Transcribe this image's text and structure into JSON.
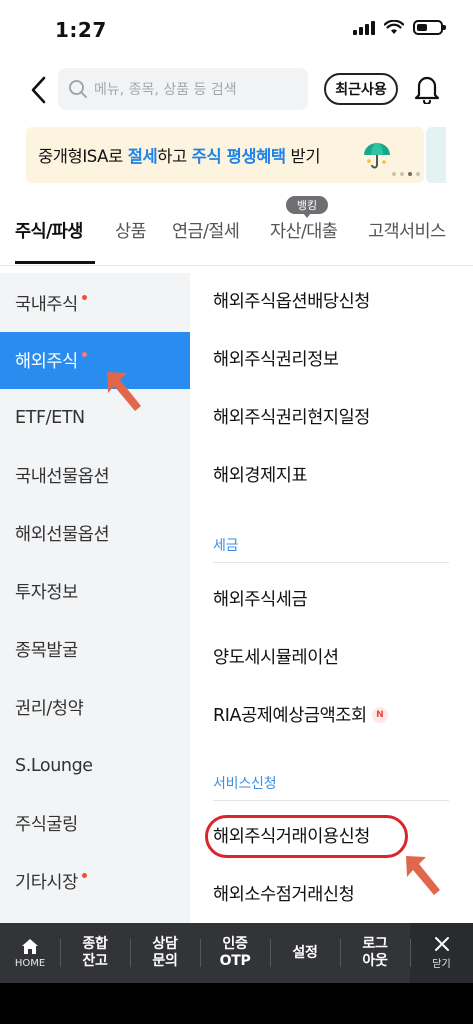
{
  "status": {
    "time": "1:27"
  },
  "header": {
    "search_placeholder": "메뉴, 종목, 상품 등 검색",
    "recent_label": "최근사용"
  },
  "banner": {
    "part1": "중개형ISA로 ",
    "part2": "절세",
    "part3": "하고 ",
    "part4": "주식 평생혜택",
    "part5": " 받기"
  },
  "tabs": [
    {
      "label": "주식/파생",
      "active": true
    },
    {
      "label": "상품"
    },
    {
      "label": "연금/절세"
    },
    {
      "label": "자산/대출"
    },
    {
      "label": "고객서비스"
    }
  ],
  "tab_badge": "뱅킹",
  "sidebar": {
    "items": [
      {
        "label": "국내주식",
        "dot": true
      },
      {
        "label": "해외주식",
        "dot": true,
        "active": true
      },
      {
        "label": "ETF/ETN"
      },
      {
        "label": "국내선물옵션"
      },
      {
        "label": "해외선물옵션"
      },
      {
        "label": "투자정보"
      },
      {
        "label": "종목발굴"
      },
      {
        "label": "권리/청약"
      },
      {
        "label": "S.Lounge"
      },
      {
        "label": "주식굴링"
      },
      {
        "label": "기타시장",
        "dot": true
      }
    ]
  },
  "content": {
    "items_top": [
      "해외주식옵션배당신청",
      "해외주식권리정보",
      "해외주식권리현지일정",
      "해외경제지표"
    ],
    "section_tax": {
      "title": "세금",
      "items": [
        "해외주식세금",
        "양도세시뮬레이션",
        "RIA공제예상금액조회"
      ],
      "new_badge": "N"
    },
    "section_service": {
      "title": "서비스신청",
      "items": [
        "해외주식거래이용신청",
        "해외소수점거래신청"
      ]
    }
  },
  "bottom_bar": {
    "home": "HOME",
    "items": [
      "종합\n잔고",
      "상담\n문의",
      "인증\nOTP",
      "설정",
      "로그\n아웃"
    ],
    "close": "닫기"
  },
  "colors": {
    "accent": "#2b8cf0",
    "section_title": "#3b8ee8",
    "annotation": "#d8262c",
    "arrow": "#e0674b",
    "banner_bg": "#fdf4df",
    "bottom_bar": "#333437"
  }
}
